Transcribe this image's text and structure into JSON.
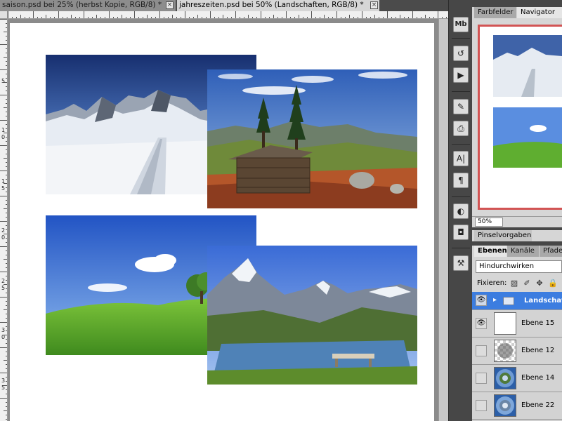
{
  "tabs": [
    {
      "label": "saison.psd bei 25% (herbst Kopie, RGB/8) *",
      "active": false
    },
    {
      "label": "jahreszeiten.psd bei 50% (Landschaften, RGB/8) *",
      "active": true
    }
  ],
  "icons": {
    "tab_close": "×",
    "mini_bridge": "Mb",
    "history": "↺",
    "actions": "▶",
    "brush": "✎",
    "clone_source": "⎙",
    "character": "A|",
    "paragraph": "¶",
    "swatch_round": "◐",
    "camera": "◘",
    "tools_preset": "⚒",
    "eye": "👁",
    "folder": "▸",
    "lock_transparent": "▨",
    "lock_paint": "✐",
    "lock_move": "✥",
    "lock_all": "🔒"
  },
  "ruler": {
    "left_labels": [
      "5",
      "1",
      "0",
      "1",
      "5",
      "2",
      "0",
      "2",
      "5",
      "3",
      "0",
      "3",
      "5"
    ]
  },
  "panels": {
    "top_tabs": [
      {
        "label": "Farbfelder",
        "active": false
      },
      {
        "label": "Navigator",
        "active": true
      }
    ],
    "zoom": "50%",
    "brush_tab": "Pinselvorgaben",
    "layer_tabs": [
      {
        "label": "Ebenen",
        "active": true
      },
      {
        "label": "Kanäle",
        "active": false
      },
      {
        "label": "Pfade",
        "active": false
      }
    ],
    "blend_mode": "Hindurchwirken",
    "lock_label": "Fixieren:",
    "layers": [
      {
        "name": "Landschaften",
        "type": "group",
        "visible": true
      },
      {
        "name": "Ebene 15",
        "type": "white",
        "visible": true
      },
      {
        "name": "Ebene 12",
        "type": "transparent",
        "visible": false
      },
      {
        "name": "Ebene 14",
        "type": "globe",
        "visible": false
      },
      {
        "name": "Ebene 22",
        "type": "globe",
        "visible": false
      }
    ]
  },
  "colors": {
    "accent": "#3c7de0",
    "navigator_frame": "#d25454",
    "sky_deep": "#1f3f86",
    "sky_light": "#4a8be0",
    "grass": "#5ea82e",
    "snow": "#e9eef5"
  }
}
